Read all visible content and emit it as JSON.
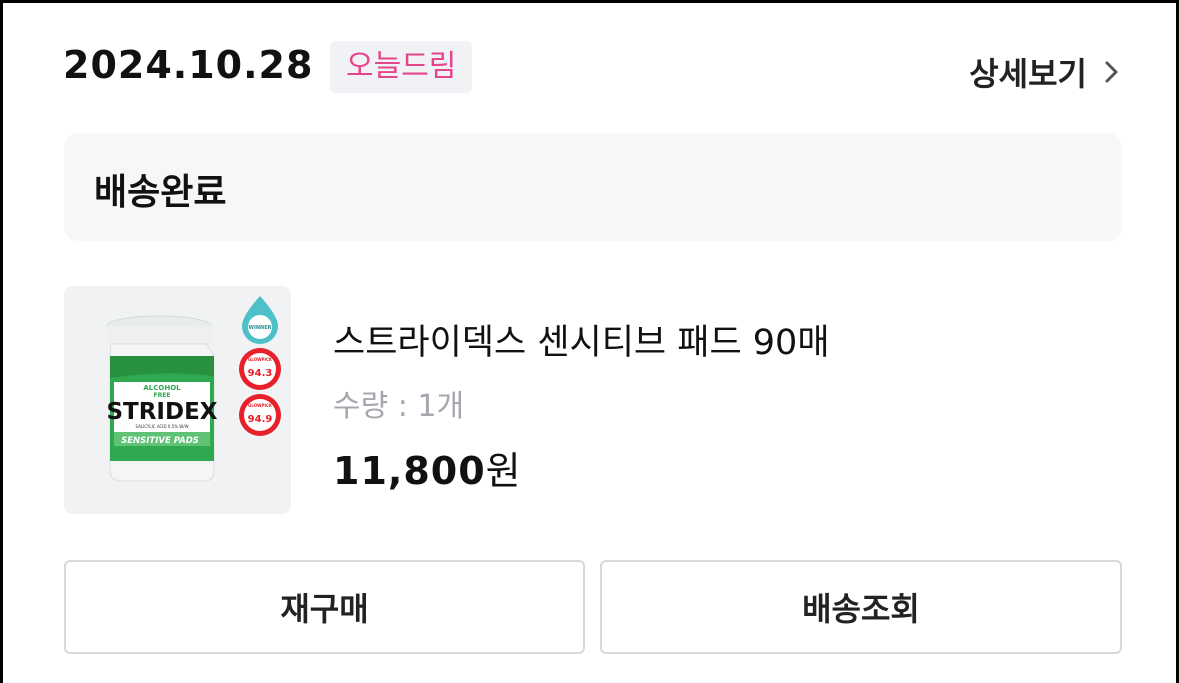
{
  "order": {
    "date": "2024.10.28",
    "badge": "오늘드림",
    "detail_label": "상세보기"
  },
  "status": {
    "label": "배송완료"
  },
  "product": {
    "name": "스트라이덱스 센시티브 패드 90매",
    "quantity": "수량 : 1개",
    "price_number": "11,800",
    "price_unit": "원",
    "image": {
      "brand": "STRIDEX",
      "line1": "ALCOHOL",
      "line2": "FREE",
      "sub": "SALICYLIC ACID 0.5% W/W",
      "band": "SENSITIVE PADS",
      "seal_top": "WINNER",
      "score1": "94.3",
      "score2": "94.9",
      "score_label": "GLOWPICK"
    }
  },
  "actions": {
    "rebuy_label": "재구매",
    "track_label": "배송조회"
  },
  "colors": {
    "badge_text": "#e4458c",
    "badge_bg": "#f1f2f6",
    "status_bg": "#f5f7f9",
    "qty_text": "#a4a7ad",
    "button_border": "#d7d9dd",
    "product_green": "#2fa84f",
    "seal_red": "#e8202a"
  }
}
